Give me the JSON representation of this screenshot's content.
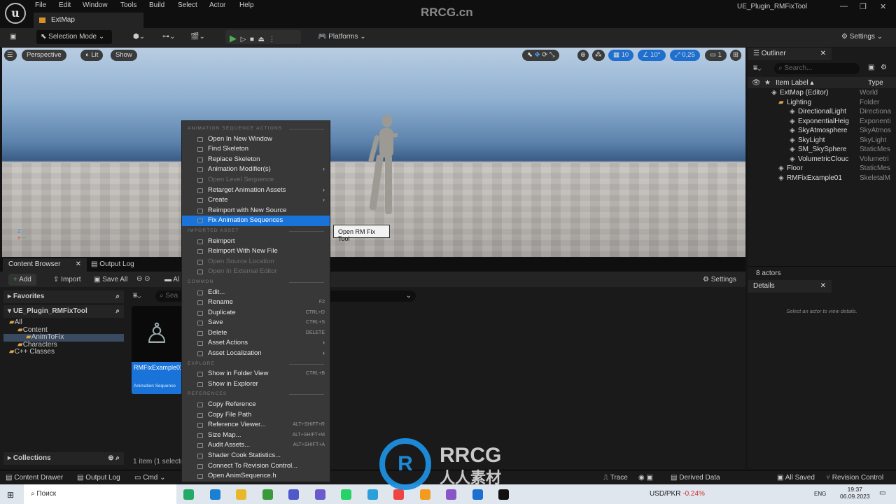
{
  "menubar": {
    "items": [
      "File",
      "Edit",
      "Window",
      "Tools",
      "Build",
      "Select",
      "Actor",
      "Help"
    ],
    "tab": "ExtMap",
    "watermark": "RRCG.cn",
    "window_title": "UE_Plugin_RMFixTool"
  },
  "toolbar": {
    "selection_mode": "Selection Mode",
    "platforms": "Platforms",
    "settings": "Settings"
  },
  "viewport": {
    "perspective": "Perspective",
    "lit": "Lit",
    "show": "Show",
    "grid": "10",
    "angle": "10°",
    "scale": "0,25",
    "camera": "1"
  },
  "outliner": {
    "title": "Outliner",
    "search_placeholder": "Search...",
    "col_label": "Item Label",
    "col_type": "Type",
    "rows": [
      {
        "label": "ExtMap (Editor)",
        "type": "World",
        "indent": 0
      },
      {
        "label": "Lighting",
        "type": "Folder",
        "indent": 1
      },
      {
        "label": "DirectionalLight",
        "type": "Directiona",
        "indent": 2
      },
      {
        "label": "ExponentialHeig",
        "type": "Exponenti",
        "indent": 2
      },
      {
        "label": "SkyAtmosphere",
        "type": "SkyAtmos",
        "indent": 2
      },
      {
        "label": "SkyLight",
        "type": "SkyLight",
        "indent": 2
      },
      {
        "label": "SM_SkySphere",
        "type": "StaticMes",
        "indent": 2
      },
      {
        "label": "VolumetricClouc",
        "type": "Volumetri",
        "indent": 2
      },
      {
        "label": "Floor",
        "type": "StaticMes",
        "indent": 1
      },
      {
        "label": "RMFixExample01",
        "type": "SkeletalM",
        "indent": 1
      }
    ],
    "count": "8 actors"
  },
  "details": {
    "title": "Details",
    "empty": "Select an actor to view details."
  },
  "content_browser": {
    "tab": "Content Browser",
    "output_tab": "Output Log",
    "add": "Add",
    "import": "Import",
    "save_all": "Save All",
    "path": "Al",
    "settings": "Settings",
    "search_placeholder": "Sea",
    "favorites": "Favorites",
    "project": "UE_Plugin_RMFixTool",
    "tree": [
      "All",
      "Content",
      "AnimToFix",
      "Characters",
      "C++ Classes"
    ],
    "asset_name": "RMFixExample01",
    "asset_type": "Animation Sequence",
    "collections": "Collections",
    "status": "1 item (1 selecte"
  },
  "context_menu": {
    "rows": [
      {
        "h": "ANIMATION SEQUENCE ACTIONS"
      },
      {
        "t": "Open In New Window"
      },
      {
        "t": "Find Skeleton"
      },
      {
        "t": "Replace Skeleton"
      },
      {
        "t": "Animation Modifier(s)",
        "sub": true
      },
      {
        "t": "Open Level Sequence",
        "dis": true
      },
      {
        "t": "Retarget Animation Assets",
        "sub": true
      },
      {
        "t": "Create",
        "sub": true
      },
      {
        "t": "Reimport with New Source"
      },
      {
        "t": "Fix Animation Sequences",
        "sel": true
      },
      {
        "h": "IMPORTED ASSET"
      },
      {
        "t": "Reimport"
      },
      {
        "t": "Reimport With New File"
      },
      {
        "t": "Open Source Location",
        "dis": true
      },
      {
        "t": "Open In External Editor",
        "dis": true
      },
      {
        "h": "COMMON"
      },
      {
        "t": "Edit..."
      },
      {
        "t": "Rename",
        "sc": "F2"
      },
      {
        "t": "Duplicate",
        "sc": "CTRL+D"
      },
      {
        "t": "Save",
        "sc": "CTRL+S"
      },
      {
        "t": "Delete",
        "sc": "DELETE"
      },
      {
        "t": "Asset Actions",
        "sub": true
      },
      {
        "t": "Asset Localization",
        "sub": true
      },
      {
        "h": "EXPLORE"
      },
      {
        "t": "Show in Folder View",
        "sc": "CTRL+B"
      },
      {
        "t": "Show in Explorer"
      },
      {
        "h": "REFERENCES"
      },
      {
        "t": "Copy Reference"
      },
      {
        "t": "Copy File Path"
      },
      {
        "t": "Reference Viewer...",
        "sc": "ALT+SHIFT+R"
      },
      {
        "t": "Size Map...",
        "sc": "ALT+SHIFT+M"
      },
      {
        "t": "Audit Assets...",
        "sc": "ALT+SHIFT+A"
      },
      {
        "t": "Shader Cook Statistics..."
      },
      {
        "t": "Connect To Revision Control..."
      },
      {
        "t": "Open AnimSequence.h"
      }
    ]
  },
  "tooltip": "Open RM Fix Tool",
  "statusbar": {
    "content_drawer": "Content Drawer",
    "output_log": "Output Log",
    "cmd": "Cmd",
    "trace": "Trace",
    "derived_data": "Derived Data",
    "all_saved": "All Saved",
    "revision_control": "Revision Control"
  },
  "taskbar": {
    "search": "Поиск",
    "ticker": "USD/PKR",
    "change": "-0.24%",
    "lang": "ENG",
    "time": "19:37",
    "date": "06.09.2023"
  },
  "logo_text": "RRCG 人人素材",
  "colors": {
    "accent": "#1a73d8",
    "play": "#4caf50",
    "folder": "#d9a64a"
  }
}
